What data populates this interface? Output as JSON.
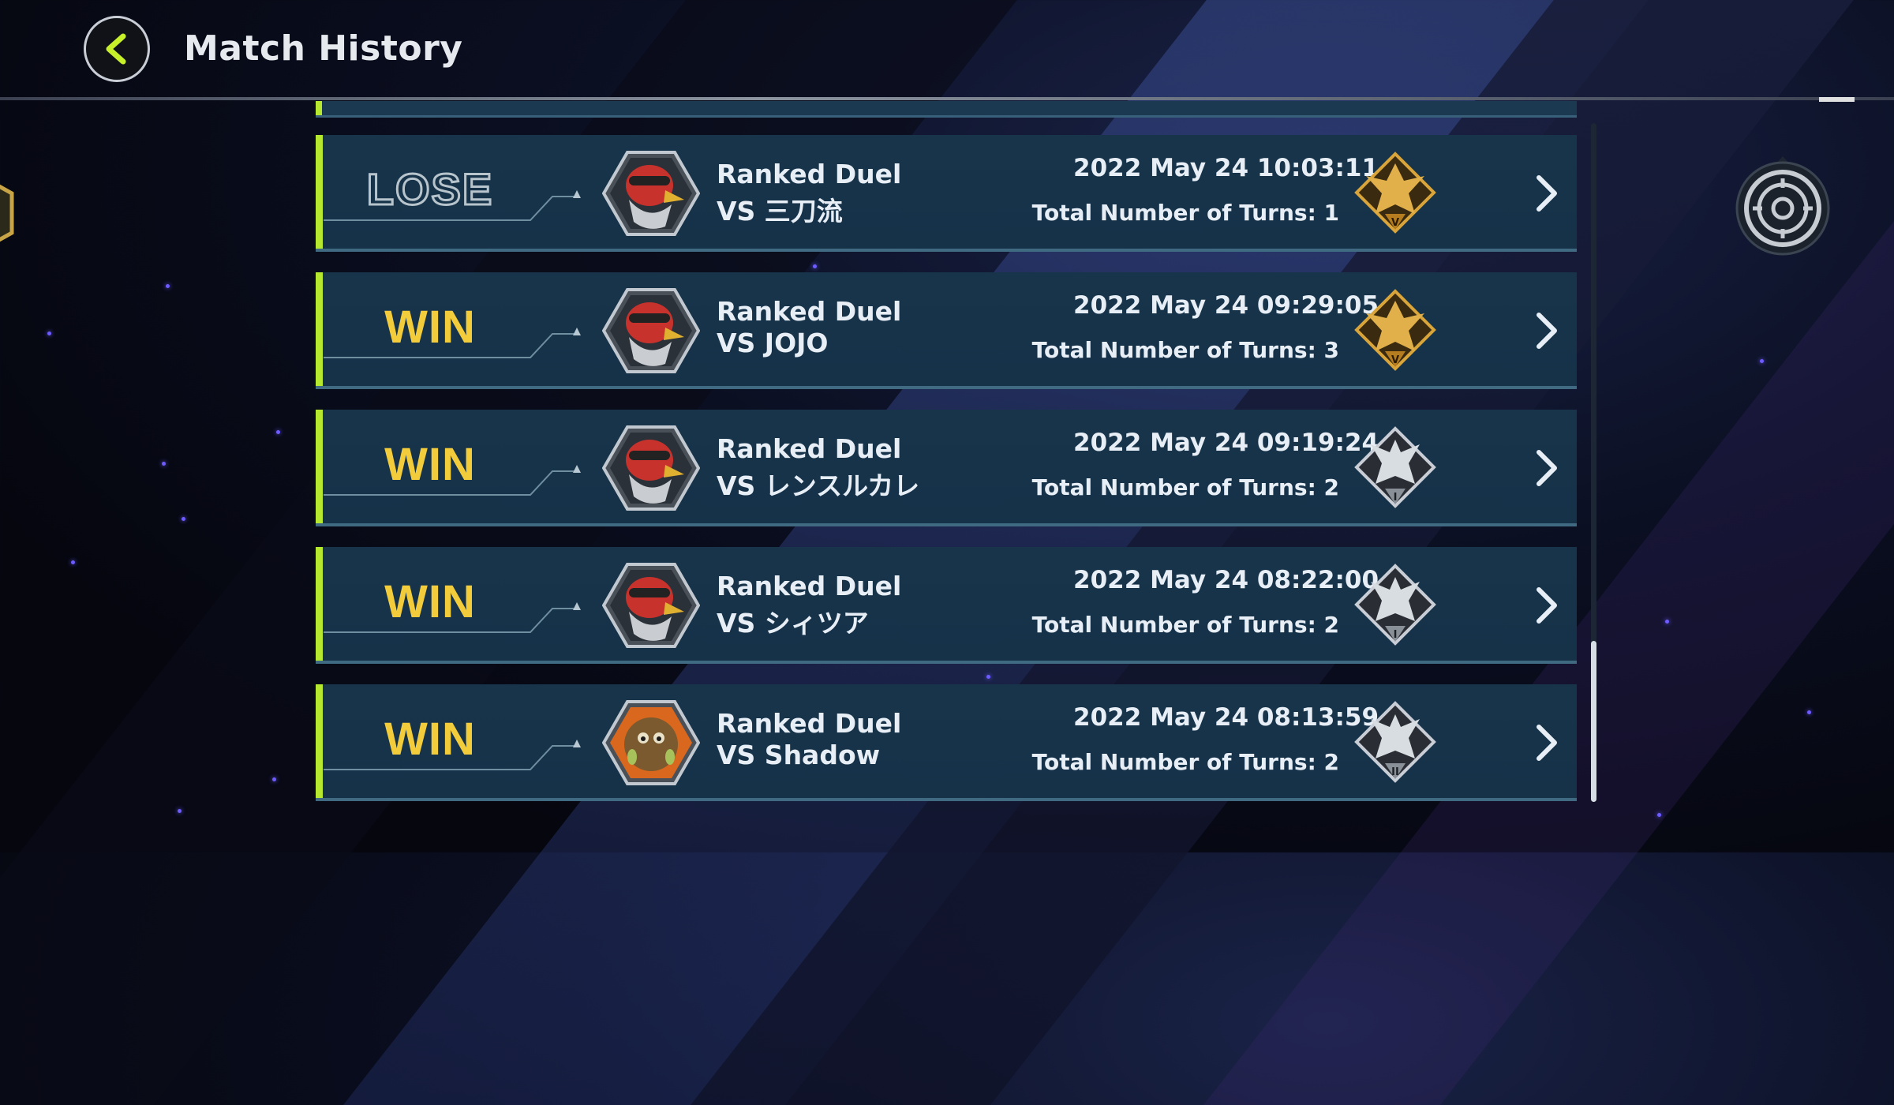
{
  "header": {
    "title": "Match History"
  },
  "matches": [
    {
      "result": "LOSE",
      "duel_type": "Ranked Duel",
      "opponent": "VS 三刀流",
      "datetime": "2022 May 24 10:03:11",
      "turns": "Total Number of Turns: 1",
      "rank": "gold",
      "rank_numeral": "V",
      "avatar": "red-bird"
    },
    {
      "result": "WIN",
      "duel_type": "Ranked Duel",
      "opponent": "VS JOJO",
      "datetime": "2022 May 24 09:29:05",
      "turns": "Total Number of Turns: 3",
      "rank": "gold",
      "rank_numeral": "V",
      "avatar": "red-bird"
    },
    {
      "result": "WIN",
      "duel_type": "Ranked Duel",
      "opponent": "VS レンスルカレ",
      "datetime": "2022 May 24 09:19:24",
      "turns": "Total Number of Turns: 2",
      "rank": "silver",
      "rank_numeral": "I",
      "avatar": "red-bird"
    },
    {
      "result": "WIN",
      "duel_type": "Ranked Duel",
      "opponent": "VS シィツア",
      "datetime": "2022 May 24 08:22:00",
      "turns": "Total Number of Turns: 2",
      "rank": "silver",
      "rank_numeral": "I",
      "avatar": "red-bird"
    },
    {
      "result": "WIN",
      "duel_type": "Ranked Duel",
      "opponent": "VS Shadow",
      "datetime": "2022 May 24 08:13:59",
      "turns": "Total Number of Turns: 2",
      "rank": "silver",
      "rank_numeral": "II",
      "avatar": "furball"
    }
  ],
  "colors": {
    "accent": "#b6e830",
    "win": "#f2cc3a",
    "row_bg": "#17344b"
  },
  "icons": {
    "back": "chevron-left-icon",
    "settings": "target-icon",
    "row": "chevron-right-icon"
  }
}
